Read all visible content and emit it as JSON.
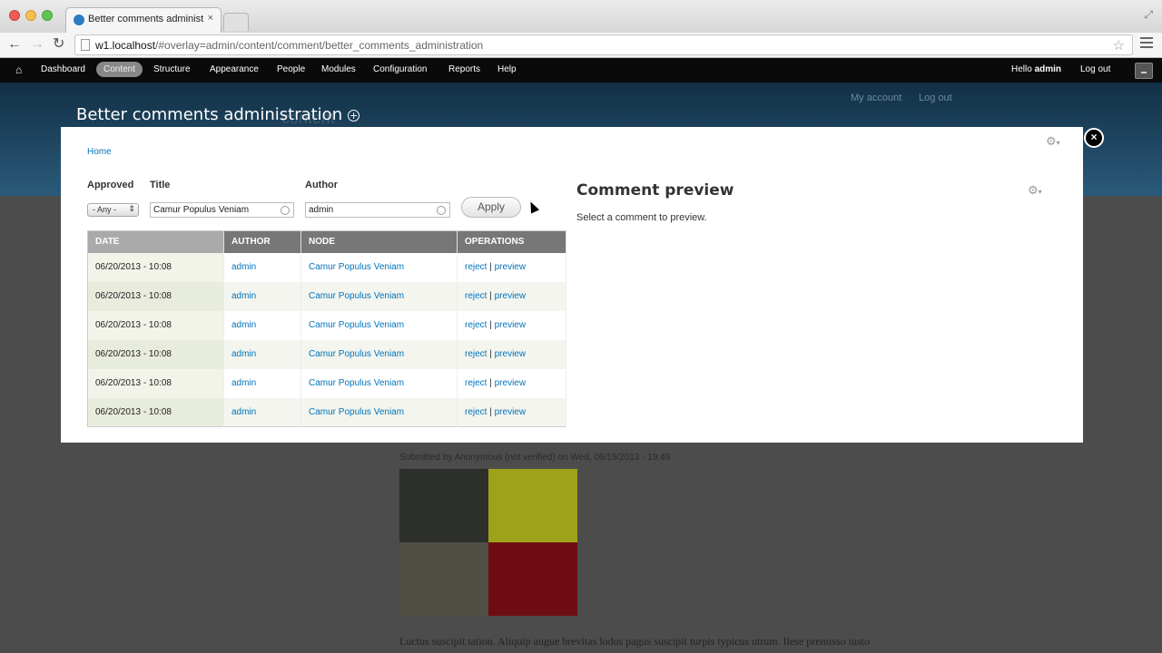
{
  "browser": {
    "tab_title": "Better comments administ",
    "tab_close": "×",
    "url_host": "w1.localhost",
    "url_path": "/#overlay=admin/content/comment/better_comments_administration",
    "back": "←",
    "forward": "→",
    "reload": "↻",
    "star": "☆",
    "resize": "⤢"
  },
  "admin_toolbar": {
    "home": "⌂",
    "items": [
      "Dashboard",
      "Content",
      "Structure",
      "Appearance",
      "People",
      "Modules",
      "Configuration",
      "Reports",
      "Help"
    ],
    "active_item": "Content",
    "hello": "Hello",
    "username": "admin",
    "logout": "Log out"
  },
  "site": {
    "secondary_menu": [
      "My account",
      "Log out"
    ],
    "node_submitted": "Submitted by Anonymous (not verified) on Wed, 06/19/2013 - 19:49",
    "node_text": "Luctus suscipit tation. Aliquip augue brevitas lodus pagus suscipit turpis typicus utrum. Ilese premisso iusto"
  },
  "overlay": {
    "title": "Better comments administration",
    "title_ghost": "content",
    "add_icon": "+",
    "close_icon": "×",
    "gear": "⚙",
    "gear_arrow": "▾",
    "breadcrumb": "Home"
  },
  "filters": {
    "approved_label": "Approved",
    "title_label": "Title",
    "author_label": "Author",
    "approved_value": "- Any -",
    "select_arrows": "⇕",
    "title_value": "Camur Populus Veniam",
    "author_value": "admin",
    "apply_label": "Apply"
  },
  "table": {
    "headers": [
      "DATE",
      "AUTHOR",
      "NODE",
      "OPERATIONS"
    ],
    "rows": [
      {
        "date": "06/20/2013 - 10:08",
        "author": "admin",
        "node": "Camur Populus Veniam",
        "op1": "reject",
        "sep": "|",
        "op2": "preview"
      },
      {
        "date": "06/20/2013 - 10:08",
        "author": "admin",
        "node": "Camur Populus Veniam",
        "op1": "reject",
        "sep": "|",
        "op2": "preview"
      },
      {
        "date": "06/20/2013 - 10:08",
        "author": "admin",
        "node": "Camur Populus Veniam",
        "op1": "reject",
        "sep": "|",
        "op2": "preview"
      },
      {
        "date": "06/20/2013 - 10:08",
        "author": "admin",
        "node": "Camur Populus Veniam",
        "op1": "reject",
        "sep": "|",
        "op2": "preview"
      },
      {
        "date": "06/20/2013 - 10:08",
        "author": "admin",
        "node": "Camur Populus Veniam",
        "op1": "reject",
        "sep": "|",
        "op2": "preview"
      },
      {
        "date": "06/20/2013 - 10:08",
        "author": "admin",
        "node": "Camur Populus Veniam",
        "op1": "reject",
        "sep": "|",
        "op2": "preview"
      }
    ]
  },
  "preview": {
    "title": "Comment preview",
    "text": "Select a comment to preview."
  },
  "colors": {
    "link": "#0074bd",
    "admin_bar": "#0a0a0a",
    "table_header": "#777777",
    "image_tiles": [
      "#2d2f2a",
      "#9ea21a",
      "#4f4f45",
      "#6e0d12"
    ]
  }
}
